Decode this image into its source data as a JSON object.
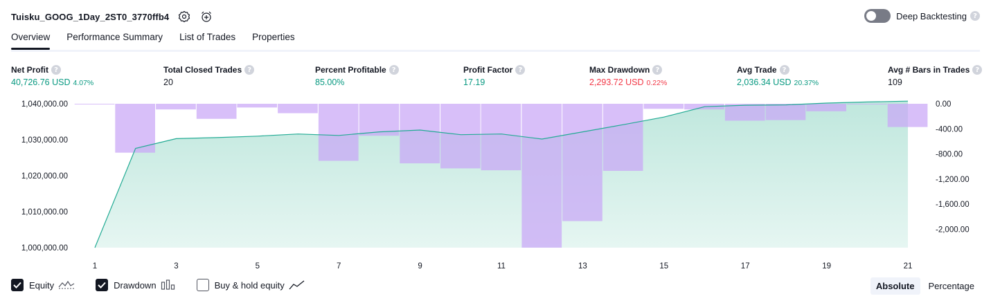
{
  "header": {
    "strategy_name": "Tuisku_GOOG_1Day_2ST0_3770ffb4",
    "settings_icon": "settings-gear-icon",
    "alert_icon": "alarm-clock-plus-icon",
    "deep_backtesting_label": "Deep Backtesting",
    "deep_backtesting_enabled": false,
    "help_glyph": "?"
  },
  "tabs": [
    {
      "label": "Overview",
      "active": true
    },
    {
      "label": "Performance Summary",
      "active": false
    },
    {
      "label": "List of Trades",
      "active": false
    },
    {
      "label": "Properties",
      "active": false
    }
  ],
  "metrics": [
    {
      "label": "Net Profit",
      "value": "40,726.76 USD",
      "pct": "4.07%",
      "color": "green"
    },
    {
      "label": "Total Closed Trades",
      "value": "20",
      "pct": "",
      "color": "dark"
    },
    {
      "label": "Percent Profitable",
      "value": "85.00%",
      "pct": "",
      "color": "green"
    },
    {
      "label": "Profit Factor",
      "value": "17.19",
      "pct": "",
      "color": "green"
    },
    {
      "label": "Max Drawdown",
      "value": "2,293.72 USD",
      "pct": "0.22%",
      "color": "red"
    },
    {
      "label": "Avg Trade",
      "value": "2,036.34 USD",
      "pct": "20.37%",
      "color": "green"
    },
    {
      "label": "Avg # Bars in Trades",
      "value": "109",
      "pct": "",
      "color": "dark"
    }
  ],
  "colors": {
    "green": "#089981",
    "red": "#f23645",
    "equity_line": "#22ab94",
    "equity_fill": "#c3e9e0",
    "drawdown_bar": "#c9a6f7",
    "text": "#131722"
  },
  "chart_data": {
    "type": "area",
    "x_ticks": [
      "1",
      "3",
      "5",
      "7",
      "9",
      "11",
      "13",
      "15",
      "17",
      "19",
      "21"
    ],
    "left_axis": {
      "ticks": [
        "1,040,000.00",
        "1,030,000.00",
        "1,020,000.00",
        "1,010,000.00",
        "1,000,000.00"
      ],
      "range": [
        1000000,
        1040000
      ]
    },
    "right_axis": {
      "ticks": [
        "0.00",
        "-400.00",
        "-800.00",
        "-1,200.00",
        "-1,600.00",
        "-2,000.00"
      ],
      "range": [
        -2293.72,
        0
      ]
    },
    "series": [
      {
        "name": "Equity",
        "x": [
          1,
          2,
          3,
          4,
          5,
          6,
          7,
          8,
          9,
          10,
          11,
          12,
          13,
          14,
          15,
          16,
          17,
          18,
          19,
          20,
          21
        ],
        "values": [
          1000000,
          1027600,
          1030300,
          1030600,
          1031000,
          1031600,
          1031200,
          1032200,
          1032700,
          1031400,
          1031600,
          1030200,
          1032200,
          1034200,
          1036300,
          1039200,
          1039600,
          1039700,
          1040200,
          1040500,
          1040727
        ]
      },
      {
        "name": "Drawdown",
        "x": [
          1,
          2,
          3,
          4,
          5,
          6,
          7,
          8,
          9,
          10,
          11,
          12,
          13,
          14,
          15,
          16,
          17,
          18,
          19,
          20,
          21
        ],
        "values": [
          -5,
          -780,
          -90,
          -240,
          -60,
          -150,
          -910,
          -510,
          -950,
          -1030,
          -1060,
          -2293.72,
          -1870,
          -1070,
          -80,
          -90,
          -270,
          -260,
          -120,
          -10,
          -370
        ]
      }
    ]
  },
  "legend": [
    {
      "label": "Equity",
      "checked": true,
      "icon": "equity-wave-icon"
    },
    {
      "label": "Drawdown",
      "checked": true,
      "icon": "drawdown-bars-icon"
    },
    {
      "label": "Buy & hold equity",
      "checked": false,
      "icon": "buy-hold-line-icon"
    }
  ],
  "modes": [
    {
      "label": "Absolute",
      "active": true
    },
    {
      "label": "Percentage",
      "active": false
    }
  ]
}
